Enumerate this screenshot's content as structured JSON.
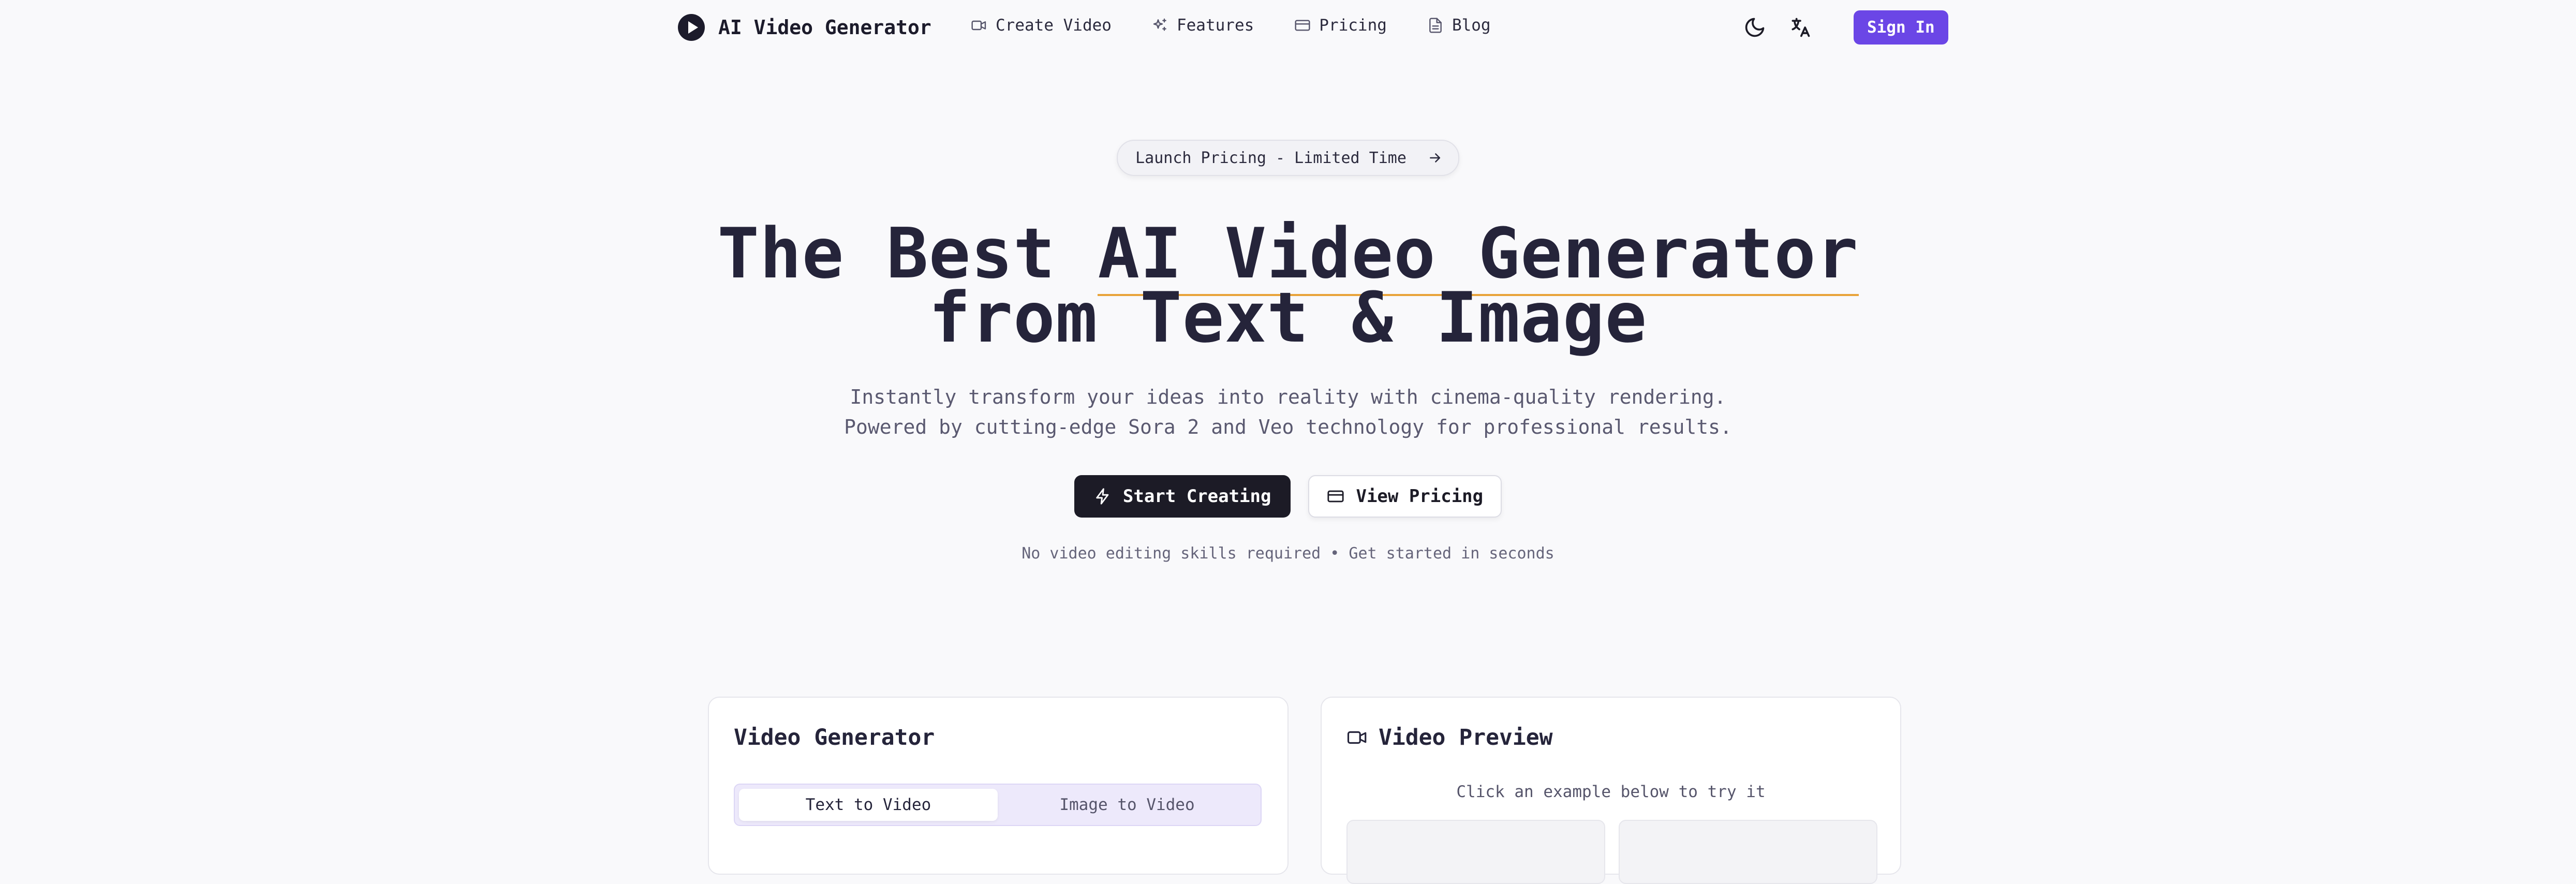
{
  "nav": {
    "brand": "AI Video Generator",
    "links": [
      {
        "label": "Create Video",
        "icon": "video-icon"
      },
      {
        "label": "Features",
        "icon": "sparkles-icon"
      },
      {
        "label": "Pricing",
        "icon": "credit-card-icon"
      },
      {
        "label": "Blog",
        "icon": "document-icon"
      }
    ],
    "signin_label": "Sign In"
  },
  "hero": {
    "badge": "Launch Pricing - Limited Time",
    "headline_part1": "The Best ",
    "headline_highlight": "AI Video Generator",
    "headline_line2": "from Text & Image",
    "sub_line1": "Instantly transform your ideas into reality with cinema-quality rendering.",
    "sub_line2": "Powered by cutting-edge Sora 2 and Veo technology for professional results.",
    "cta_primary": "Start Creating",
    "cta_secondary": "View Pricing",
    "note": "No video editing skills required • Get started in seconds"
  },
  "generator": {
    "title": "Video Generator",
    "tabs": [
      "Text to Video",
      "Image to Video"
    ]
  },
  "preview": {
    "title": "Video Preview",
    "hint": "Click an example below to try it"
  },
  "colors": {
    "accent": "#6b46e6",
    "highlight_underline": "#e8a33a",
    "dark": "#1c1b26"
  }
}
